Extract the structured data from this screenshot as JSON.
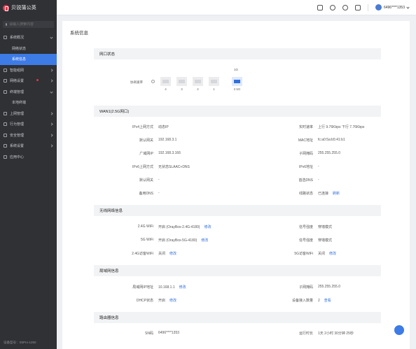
{
  "app": {
    "logo_text": "贝锐蒲公英"
  },
  "sidebar": {
    "search_placeholder": "请输入搜索内容",
    "items": [
      {
        "label": "系统概况",
        "expanded": true
      },
      {
        "label": "网络状态",
        "sub": true
      },
      {
        "label": "系统信息",
        "sub": true,
        "active": true
      },
      {
        "label": "智能组网"
      },
      {
        "label": "网络设置"
      },
      {
        "label": "终端管理",
        "expanded": true
      },
      {
        "label": "本地终端",
        "sub": true
      },
      {
        "label": "上网管理"
      },
      {
        "label": "行为管理"
      },
      {
        "label": "安全管理"
      },
      {
        "label": "系统设置"
      },
      {
        "label": "应用中心"
      }
    ],
    "footer": "设备型号：X5Pro-1250"
  },
  "topbar": {
    "user": "6496****1353"
  },
  "page": {
    "title": "系统信息"
  },
  "port_status": {
    "title": "网口状态",
    "label": "协商速率",
    "ports": [
      {
        "name": "4",
        "active": false
      },
      {
        "name": "3",
        "active": false
      },
      {
        "name": "2",
        "active": false
      },
      {
        "name": "1",
        "active": false
      },
      {
        "name": "2.5G",
        "active": true
      }
    ],
    "active_speed": "1G"
  },
  "wan": {
    "title": "WAN1(2.5G网口)",
    "rows": [
      {
        "k": "IPv4上网方式",
        "v": "动态IP",
        "k2": "实时速率",
        "v2": "上行 9.76Kbps    下行 7.76Kbps"
      },
      {
        "k": "默认网关",
        "v": "192.168.3.1",
        "k2": "MAC地址",
        "v2": "fc:a0:5a:b5:41:b1"
      },
      {
        "k": "广域网IP",
        "v": "192.168.3.166",
        "k2": "子网掩码",
        "v2": "255.255.255.0"
      },
      {
        "k": "IPv6上网方式",
        "v": "无状态SLAAC+DNS",
        "k2": "IPv6地址",
        "v2": "-"
      },
      {
        "k": "默认网关",
        "v": "-",
        "k2": "首选DNS",
        "v2": "-"
      },
      {
        "k": "备用DNS",
        "v": "-",
        "k2": "线路状态",
        "v2": "已连接",
        "v2_link": "刷新"
      }
    ]
  },
  "wireless": {
    "title": "无线网络信息",
    "rows": [
      {
        "k": "2.4G WiFi",
        "v": "开启 (OrayBox-2.4G-4180)",
        "v_link": "修改",
        "k2": "信号强度",
        "v2": "穿墙模式"
      },
      {
        "k": "5G WiFi",
        "v": "开启 (OrayBox-5G-4180)",
        "v_link": "修改",
        "k2": "信号强度",
        "v2": "穿墙模式"
      },
      {
        "k": "2.4G访客WiFi",
        "v": "关闭",
        "v_link": "修改",
        "k2": "5G访客WiFi",
        "v2": "关闭",
        "v2_link": "修改"
      }
    ]
  },
  "lan": {
    "title": "局域网信息",
    "rows": [
      {
        "k": "局域网IP地址",
        "v": "10.168.1.1",
        "v_link": "修改",
        "k2": "子网掩码",
        "v2": "255.255.255.0"
      },
      {
        "k": "DHCP状态",
        "v": "开启",
        "v_link": "修改",
        "k2": "设备接入数量",
        "v2": "2",
        "v2_link": "查看"
      }
    ]
  },
  "router": {
    "title": "路由器信息",
    "rows": [
      {
        "k": "SN码",
        "v": "6496****1353",
        "k2": "运行时长",
        "v2": "1天 2小时 30分钟 25秒"
      }
    ]
  }
}
